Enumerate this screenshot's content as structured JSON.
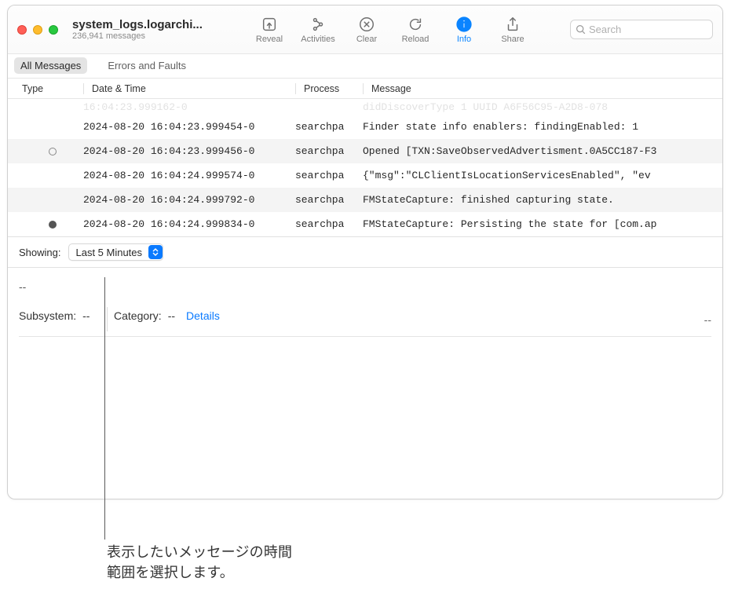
{
  "window": {
    "title": "system_logs.logarchi...",
    "subtitle": "236,941 messages"
  },
  "toolbar": {
    "reveal": "Reveal",
    "activities": "Activities",
    "clear": "Clear",
    "reload": "Reload",
    "info": "Info",
    "share": "Share",
    "search_placeholder": "Search"
  },
  "scope": {
    "all": "All Messages",
    "errors": "Errors and Faults"
  },
  "columns": {
    "type": "Type",
    "date": "Date & Time",
    "process": "Process",
    "message": "Message"
  },
  "ghost": {
    "date": "  16:04:23.999162-0",
    "msg": "        didDiscoverType 1 UUID A6F56C95-A2D8-078"
  },
  "rows": [
    {
      "type": "",
      "date": "2024-08-20 16:04:23.999454-0",
      "proc": "searchpa",
      "msg": "Finder state info enablers:   findingEnabled: 1"
    },
    {
      "type": "hollow",
      "date": "2024-08-20 16:04:23.999456-0",
      "proc": "searchpa",
      "msg": "Opened [TXN:SaveObservedAdvertisment.0A5CC187-F3"
    },
    {
      "type": "",
      "date": "2024-08-20 16:04:24.999574-0",
      "proc": "searchpa",
      "msg": "{\"msg\":\"CLClientIsLocationServicesEnabled\", \"ev"
    },
    {
      "type": "",
      "date": "2024-08-20 16:04:24.999792-0",
      "proc": "searchpa",
      "msg": "FMStateCapture: finished capturing state."
    },
    {
      "type": "solid",
      "date": "2024-08-20 16:04:24.999834-0",
      "proc": "searchpa",
      "msg": "FMStateCapture: Persisting the state for [com.ap"
    }
  ],
  "showing": {
    "label": "Showing:",
    "value": "Last 5 Minutes"
  },
  "detail": {
    "top": "--",
    "subsystem_label": "Subsystem:",
    "subsystem_value": "--",
    "category_label": "Category:",
    "category_value": "--",
    "details_link": "Details",
    "right_dash": "--"
  },
  "callout": {
    "line1": "表示したいメッセージの時間",
    "line2": "範囲を選択します。"
  }
}
